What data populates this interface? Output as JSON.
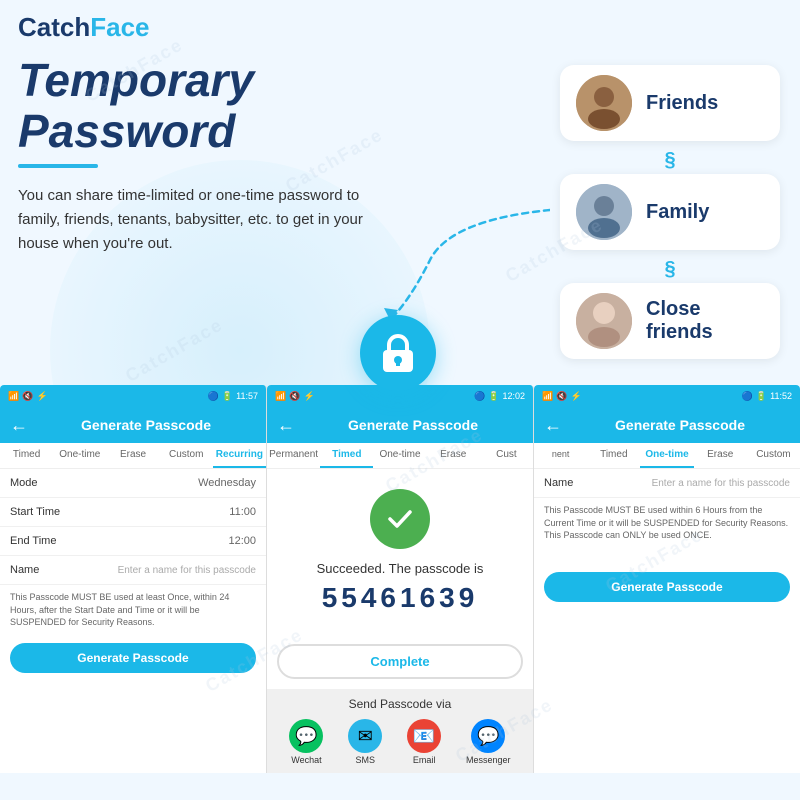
{
  "app": {
    "logo_catch": "Catch",
    "logo_face": "Face"
  },
  "hero": {
    "title_line1": "Temporary",
    "title_line2": "Password",
    "description": "You can share time-limited or one-time password to family, friends, tenants, babysitter, etc. to get in your house when you're out."
  },
  "avatars": [
    {
      "id": "friends",
      "label": "Friends",
      "color": "#7a6b5a",
      "emoji": "👨"
    },
    {
      "id": "family",
      "label": "Family",
      "color": "#5a7a6b",
      "emoji": "👨‍🦳"
    },
    {
      "id": "close-friends",
      "label": "Close friends",
      "color": "#6b7a5a",
      "emoji": "👩‍🦳"
    }
  ],
  "watermarks": [
    "CatchFace",
    "CatchFace",
    "CatchFace",
    "CatchFace",
    "CatchFace",
    "CatchFace"
  ],
  "phones": [
    {
      "id": "left-phone",
      "status_left": "📶 🔇 ⚡",
      "status_right": "🔵 🔋 11:57",
      "header_title": "Generate Passcode",
      "tabs": [
        "Timed",
        "One-time",
        "Erase",
        "Custom",
        "Recurring"
      ],
      "active_tab": "Recurring",
      "fields": [
        {
          "label": "Mode",
          "value": "Wednesday",
          "type": "value"
        },
        {
          "label": "Start Time",
          "value": "11:00",
          "type": "value"
        },
        {
          "label": "End Time",
          "value": "12:00",
          "type": "value"
        },
        {
          "label": "Name",
          "value": "",
          "placeholder": "Enter a name for this passcode",
          "type": "input"
        }
      ],
      "note": "This Passcode MUST BE used at least Once, within 24 Hours, after the Start Date and Time or it will be SUSPENDED for Security Reasons.",
      "button_label": "Generate Passcode"
    },
    {
      "id": "middle-phone",
      "status_left": "📶 🔇 ⚡",
      "status_right": "🔵 🔋 12:02",
      "header_title": "Generate Passcode",
      "tabs": [
        "Permanent",
        "Timed",
        "One-time",
        "Erase",
        "Cust"
      ],
      "active_tab": "Timed",
      "success_text": "Succeeded. The passcode is",
      "passcode": "55461639",
      "complete_label": "Complete",
      "send_via_title": "Send Passcode via",
      "send_icons": [
        {
          "label": "Wechat",
          "color": "#07C160",
          "symbol": "💬"
        },
        {
          "label": "SMS",
          "color": "#29b6e8",
          "symbol": "✉"
        },
        {
          "label": "Email",
          "color": "#ea4335",
          "symbol": "📧"
        },
        {
          "label": "Messenger",
          "color": "#0084ff",
          "symbol": "💬"
        }
      ]
    },
    {
      "id": "right-phone",
      "status_left": "📶 🔇 ⚡",
      "status_right": "🔵 🔋 11:52",
      "header_title": "Generate Passcode",
      "tabs": [
        "nent",
        "Timed",
        "One-time",
        "Erase",
        "Custom"
      ],
      "active_tab": "One-time",
      "fields": [
        {
          "label": "Name",
          "value": "",
          "placeholder": "Enter a name for this passcode",
          "type": "input"
        }
      ],
      "note": "This Passcode MUST BE used within 6 Hours from the Current Time or it will be SUSPENDED for Security Reasons. This Passcode can ONLY be used ONCE.",
      "button_label": "Generate Passcode"
    }
  ],
  "lock_icon": "🔒"
}
